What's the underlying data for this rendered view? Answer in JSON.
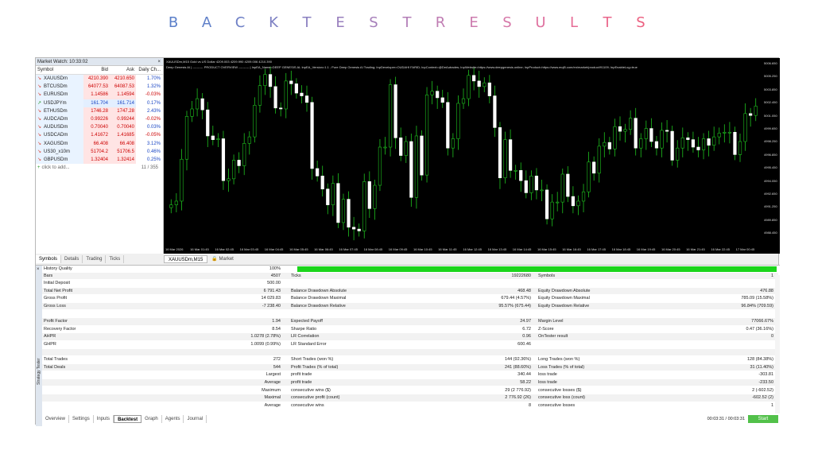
{
  "banner": {
    "letters": [
      "B",
      "A",
      "C",
      "K",
      "T",
      "E",
      "S",
      "T",
      "R",
      "E",
      "S",
      "U",
      "L",
      "T",
      "S"
    ],
    "colors": [
      "#5b7fc9",
      "#6181c9",
      "#6f80c6",
      "#7d80c3",
      "#8a80c0",
      "#987fbd",
      "#a67fba",
      "#b37eb7",
      "#c07db3",
      "#cc7aae",
      "#d677a8",
      "#df72a0",
      "#e66c96",
      "#ea668b",
      "#ec6080"
    ]
  },
  "market_watch": {
    "title": "Market Watch: 10:33:02",
    "headers": {
      "symbol": "Symbol",
      "bid": "Bid",
      "ask": "Ask",
      "change": "Daily Ch..."
    },
    "rows": [
      {
        "symbol": "XAUUSDm",
        "bid": "4210.390",
        "ask": "4210.650",
        "change": "1.70%",
        "dir": "down"
      },
      {
        "symbol": "BTCUSDm",
        "bid": "64077.53",
        "ask": "64087.53",
        "change": "1.32%",
        "dir": "down"
      },
      {
        "symbol": "EURUSDm",
        "bid": "1.14586",
        "ask": "1.14594",
        "change": "-0.03%",
        "dir": "down"
      },
      {
        "symbol": "USDJPYm",
        "bid": "161.704",
        "ask": "161.714",
        "change": "0.17%",
        "dir": "up"
      },
      {
        "symbol": "ETHUSDm",
        "bid": "1746.28",
        "ask": "1747.28",
        "change": "2.43%",
        "dir": "down"
      },
      {
        "symbol": "AUDCADm",
        "bid": "0.99226",
        "ask": "0.99244",
        "change": "-0.02%",
        "dir": "down"
      },
      {
        "symbol": "AUDUSDm",
        "bid": "0.70040",
        "ask": "0.70040",
        "change": "0.03%",
        "dir": "down"
      },
      {
        "symbol": "USDCADm",
        "bid": "1.41672",
        "ask": "1.41685",
        "change": "-0.05%",
        "dir": "down"
      },
      {
        "symbol": "XAGUSDm",
        "bid": "66.408",
        "ask": "66.408",
        "change": "3.12%",
        "dir": "down"
      },
      {
        "symbol": "US30_x10m",
        "bid": "51704.2",
        "ask": "51706.5",
        "change": "0.46%",
        "dir": "down"
      },
      {
        "symbol": "GBPUSDm",
        "bid": "1.32404",
        "ask": "1.32414",
        "change": "0.25%",
        "dir": "down"
      }
    ],
    "add_label": "click to add...",
    "count": "11 / 355",
    "tabs": [
      "Symbols",
      "Details",
      "Trading",
      "Ticks"
    ]
  },
  "chart": {
    "header": "XAUUSDm,M15 Gold vs US Dollar 4209.003 4209.990 4209.006 4210.390",
    "info_line": "Deep Genesis AI | ---------- PRODUCT OVERVIEW ---------- | InpEA_Name=DEEP GENESIS AI; InpEA_Version=1.1 ; Pure Deep Genesis AI Trading; InpDeveloper=OUDAHI FARID; InpContext=@DeAutrades; InpWebsite=https://www.deepgenesis.online; InpProduct=https://www.mql5.com/en/market/product/91109; InpEnableLog=true",
    "price_ticks": [
      "5006.650",
      "5005.250",
      "5003.850",
      "5002.450",
      "5001.050",
      "4999.650",
      "4998.250",
      "4996.850",
      "4995.450",
      "4994.050",
      "4992.650",
      "4991.250",
      "4989.850",
      "4988.450"
    ],
    "time_ticks": [
      "16 Mar 2026",
      "16 Mar 01:45",
      "16 Mar 02:45",
      "16 Mar 03:45",
      "16 Mar 04:45",
      "16 Mar 05:45",
      "16 Mar 06:45",
      "16 Mar 07:45",
      "16 Mar 08:45",
      "16 Mar 09:45",
      "16 Mar 10:45",
      "16 Mar 11:45",
      "16 Mar 12:45",
      "16 Mar 13:45",
      "16 Mar 14:45",
      "16 Mar 15:45",
      "16 Mar 16:45",
      "16 Mar 17:45",
      "16 Mar 18:45",
      "16 Mar 19:45",
      "16 Mar 20:45",
      "16 Mar 21:45",
      "16 Mar 22:45",
      "17 Mar 00:45"
    ],
    "closes": [
      4991.4,
      4991.8,
      4996.3,
      5000.9,
      5001.7,
      5002.8,
      5001.6,
      4998.8,
      4998.4,
      4998.5,
      4994.0,
      4994.2,
      4996.2,
      4995.6,
      4998.0,
      4998.7,
      5002.1,
      5004.2,
      5005.4,
      5004.1,
      5001.8,
      5001.7,
      5004.7,
      5004.4,
      5003.4,
      5003.1,
      5002.4,
      4995.3,
      4994.5,
      4993.1,
      4991.4,
      4993.7,
      4989.5,
      4992.0,
      4989.0,
      4988.8,
      4988.6,
      4993.9,
      4991.0,
      4993.5,
      4997.6,
      4997.6,
      5004.3,
      4998.6,
      4996.7,
      4998.2,
      4992.2,
      4998.8,
      4994.6,
      5003.2,
      5003.6,
      5002.9,
      5002.4,
      4997.5,
      4998.5,
      5002.3,
      5002.8,
      5005.3,
      5004.7,
      5004.1,
      5004.5,
      5003.1,
      4999.7,
      4994.3,
      4998.4,
      4995.1,
      4995.1,
      4994.0,
      4992.7,
      4994.5,
      4993.0,
      4993.0,
      4989.9,
      4991.7,
      4991.7,
      4994.7,
      4992.3,
      4991.3,
      4991.8,
      4992.8,
      4996.0,
      4994.8,
      4997.7,
      4998.1,
      4997.4,
      4999.8,
      4999.3,
      4999.5,
      5000.7,
      4997.5,
      4998.5,
      4999.6,
      4998.2,
      4997.5,
      4999.4,
      4999.3,
      4996.2,
      4997.5,
      4998.6,
      4998.4,
      4997.6,
      4997.3,
      4998.5,
      4997.8,
      4998.7,
      4999.1,
      4999.2,
      4999.2,
      4996.8,
      4998.2,
      5001.2,
      5001.0,
      5002.0
    ]
  },
  "chart_tabs": [
    "XAUUSDm,M15",
    "Market"
  ],
  "tester": {
    "side_label": "Strategy Tester",
    "history_quality": {
      "label": "History Quality",
      "value": "100%"
    },
    "rows": [
      [
        {
          "l": "Bars",
          "v": "4507"
        },
        {
          "l": "Ticks",
          "v": "19222680"
        },
        {
          "l": "Symbols",
          "v": "1"
        }
      ],
      [
        {
          "l": "Initial Deposit",
          "v": "500.00"
        },
        {
          "l": "",
          "v": ""
        },
        {
          "l": "",
          "v": ""
        }
      ],
      [
        {
          "l": "Total Net Profit",
          "v": "6 791.43"
        },
        {
          "l": "Balance Drawdown Absolute",
          "v": "468.48"
        },
        {
          "l": "Equity Drawdown Absolute",
          "v": "476.88"
        }
      ],
      [
        {
          "l": "Gross Profit",
          "v": "14 029.83"
        },
        {
          "l": "Balance Drawdown Maximal",
          "v": "679.44 (4.57%)"
        },
        {
          "l": "Equity Drawdown Maximal",
          "v": "785.09 (15.58%)"
        }
      ],
      [
        {
          "l": "Gross Loss",
          "v": "-7 238.40"
        },
        {
          "l": "Balance Drawdown Relative",
          "v": "95.57% (675.44)"
        },
        {
          "l": "Equity Drawdown Relative",
          "v": "96.84% (709.59)"
        }
      ],
      [
        {
          "l": "",
          "v": ""
        },
        {
          "l": "",
          "v": ""
        },
        {
          "l": "",
          "v": ""
        }
      ],
      [
        {
          "l": "Profit Factor",
          "v": "1.94"
        },
        {
          "l": "Expected Payoff",
          "v": "24.97"
        },
        {
          "l": "Margin Level",
          "v": "77066.67%"
        }
      ],
      [
        {
          "l": "Recovery Factor",
          "v": "8.54"
        },
        {
          "l": "Sharpe Ratio",
          "v": "6.72"
        },
        {
          "l": "Z-Score",
          "v": "0.47 (36.16%)"
        }
      ],
      [
        {
          "l": "AHPR",
          "v": "1.0278 (2.78%)"
        },
        {
          "l": "LR Correlation",
          "v": "0.96"
        },
        {
          "l": "OnTester result",
          "v": "0"
        }
      ],
      [
        {
          "l": "GHPR",
          "v": "1.0099 (0.99%)"
        },
        {
          "l": "LR Standard Error",
          "v": "600.46"
        },
        {
          "l": "",
          "v": ""
        }
      ],
      [
        {
          "l": "",
          "v": ""
        },
        {
          "l": "",
          "v": ""
        },
        {
          "l": "",
          "v": ""
        }
      ],
      [
        {
          "l": "Total Trades",
          "v": "272"
        },
        {
          "l": "Short Trades (won %)",
          "v": "144 (92.36%)"
        },
        {
          "l": "Long Trades (won %)",
          "v": "128 (84.38%)"
        }
      ],
      [
        {
          "l": "Total Deals",
          "v": "544"
        },
        {
          "l": "Profit Trades (% of total)",
          "v": "241 (88.60%)"
        },
        {
          "l": "Loss Trades (% of total)",
          "v": "31 (11.40%)"
        }
      ],
      [
        {
          "l": "",
          "v": "Largest"
        },
        {
          "l": "profit trade",
          "v": "340.44"
        },
        {
          "l": "loss trade",
          "v": "-303.81"
        }
      ],
      [
        {
          "l": "",
          "v": "Average"
        },
        {
          "l": "profit trade",
          "v": "58.22"
        },
        {
          "l": "loss trade",
          "v": "-233.50"
        }
      ],
      [
        {
          "l": "",
          "v": "Maximum"
        },
        {
          "l": "consecutive wins ($)",
          "v": "29 (2 776.92)"
        },
        {
          "l": "consecutive losses ($)",
          "v": "2 (-602.52)"
        }
      ],
      [
        {
          "l": "",
          "v": "Maximal"
        },
        {
          "l": "consecutive profit (count)",
          "v": "2 776.92 (26)"
        },
        {
          "l": "consecutive loss (count)",
          "v": "-602.52 (2)"
        }
      ],
      [
        {
          "l": "",
          "v": "Average"
        },
        {
          "l": "consecutive wins",
          "v": "8"
        },
        {
          "l": "consecutive losses",
          "v": "1"
        }
      ]
    ],
    "tabs": [
      "Overview",
      "Settings",
      "Inputs",
      "Backtest",
      "Graph",
      "Agents",
      "Journal"
    ],
    "active_tab": "Backtest",
    "time": "00:03:31 / 00:03:31",
    "start_label": "Start"
  }
}
